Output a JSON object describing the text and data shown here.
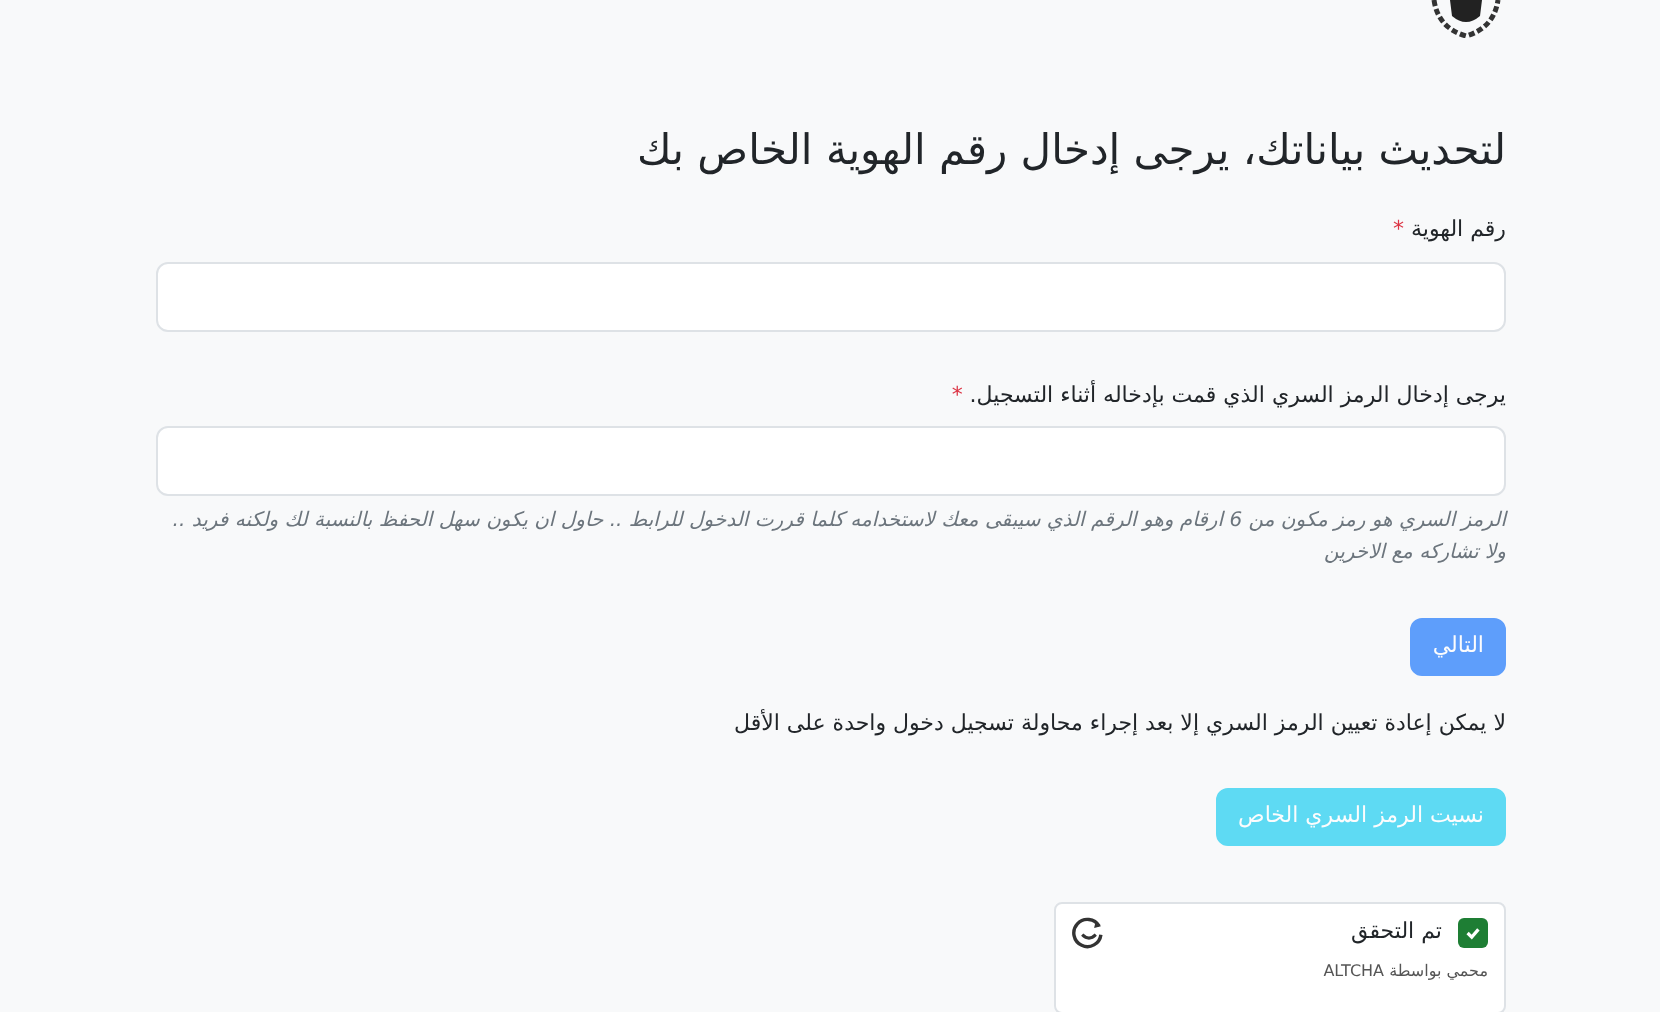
{
  "heading": "لتحديث بياناتك، يرجى إدخال رقم الهوية الخاص بك",
  "fields": [
    {
      "label": "رقم الهوية",
      "required": true,
      "mark": "*"
    },
    {
      "label": "يرجى إدخال الرمز السري الذي قمت بإدخاله أثناء التسجيل.",
      "required": true,
      "mark": "*",
      "help": "الرمز السري هو رمز مكون من 6 ارقام وهو الرقم الذي سيبقى معك لاستخدامه كلما قررت الدخول للرابط .. حاول ان يكون سهل الحفظ بالنسبة لك ولكنه فريد .. ولا تشاركه مع الاخرين"
    }
  ],
  "next_button": {
    "label": "التالي",
    "disabled": true
  },
  "reset_note": "لا يمكن إعادة تعيين الرمز السري إلا بعد إجراء محاولة تسجيل دخول واحدة على الأقل",
  "forgot_button": {
    "label": "نسيت الرمز السري الخاص",
    "disabled": true
  },
  "captcha": {
    "label": "تم التحقق",
    "checked": true,
    "footer": "محمي بواسطة ALTCHA"
  }
}
